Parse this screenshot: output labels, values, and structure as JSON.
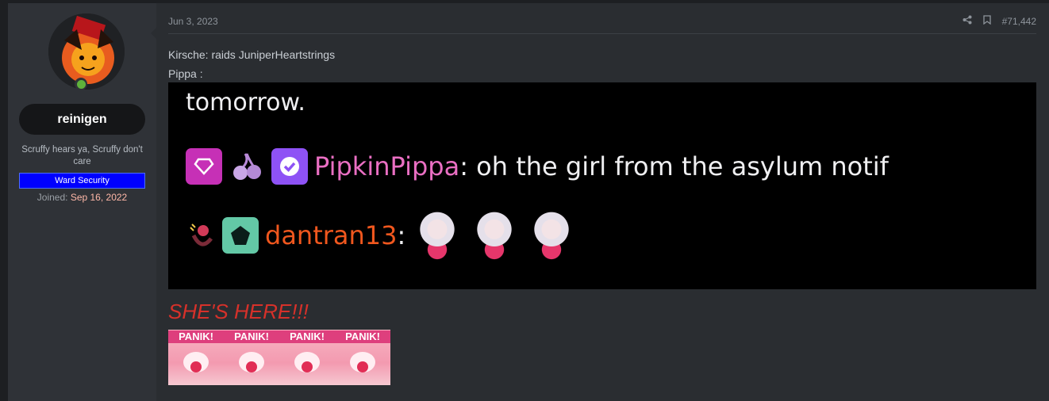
{
  "post": {
    "date": "Jun 3, 2023",
    "post_number": "#71,442",
    "lines": [
      "Kirsche: raids JuniperHeartstrings",
      "Pippa :"
    ],
    "heading": "SHE'S HERE!!!"
  },
  "user": {
    "name": "reinigen",
    "title": "Scruffy hears ya, Scruffy don't care",
    "badge": "Ward Security",
    "joined_label": "Joined:",
    "joined_date": "Sep 16, 2022"
  },
  "embed": {
    "top_text": "tomorrow.",
    "chat": [
      {
        "user": "PipkinPippa",
        "message": ": oh the girl from the asylum notif"
      },
      {
        "user": "dantran13",
        "message": ":"
      }
    ]
  },
  "panik": {
    "label": "PANIK!",
    "count": 4
  },
  "icons": [
    "share-icon",
    "bookmark-icon",
    "online-status-icon"
  ],
  "colors": {
    "accent": "#d6312a",
    "username_pink": "#ea6fc3",
    "username_orange": "#f0571e",
    "badge": "#0000ff"
  }
}
